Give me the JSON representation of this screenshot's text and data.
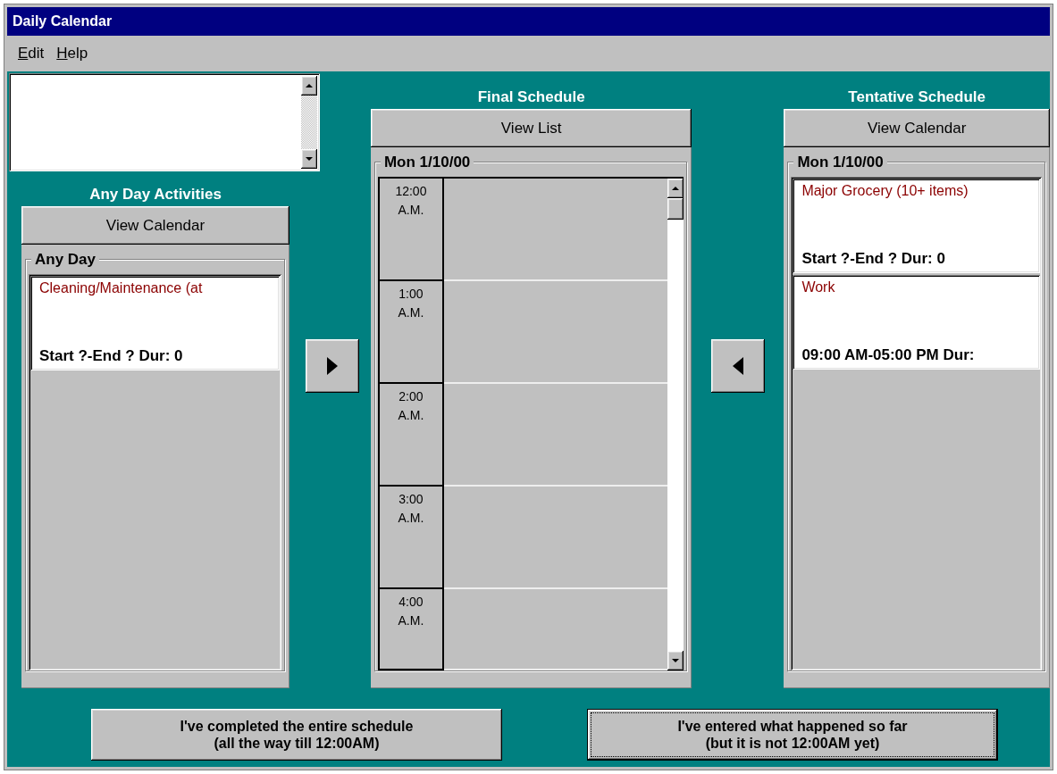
{
  "window": {
    "title": "Daily Calendar"
  },
  "menu": [
    {
      "label": "Edit"
    },
    {
      "label": "Help"
    }
  ],
  "any_day": {
    "title": "Any Day Activities",
    "button": "View Calendar",
    "group": "Any Day",
    "items": [
      {
        "name": "Cleaning/Maintenance (at",
        "times": "Start ?-End ? Dur: 0"
      }
    ]
  },
  "final": {
    "title": "Final Schedule",
    "button": "View List",
    "group": "Mon 1/10/00",
    "slots": [
      {
        "hour": "12:00",
        "period": "A.M."
      },
      {
        "hour": "1:00",
        "period": "A.M."
      },
      {
        "hour": "2:00",
        "period": "A.M."
      },
      {
        "hour": "3:00",
        "period": "A.M."
      },
      {
        "hour": "4:00",
        "period": "A.M."
      }
    ]
  },
  "tentative": {
    "title": "Tentative Schedule",
    "button": "View Calendar",
    "group": "Mon 1/10/00",
    "items": [
      {
        "name": "Major Grocery (10+ items)",
        "times": "Start ?-End ? Dur: 0"
      },
      {
        "name": "Work",
        "times": "09:00 AM-05:00 PM Dur:"
      }
    ]
  },
  "footer_buttons": [
    {
      "label": "I've completed the entire schedule\n(all the way till 12:00AM)",
      "default": false
    },
    {
      "label": "I've entered what happened so far\n(but it is not 12:00AM yet)",
      "default": true
    }
  ]
}
